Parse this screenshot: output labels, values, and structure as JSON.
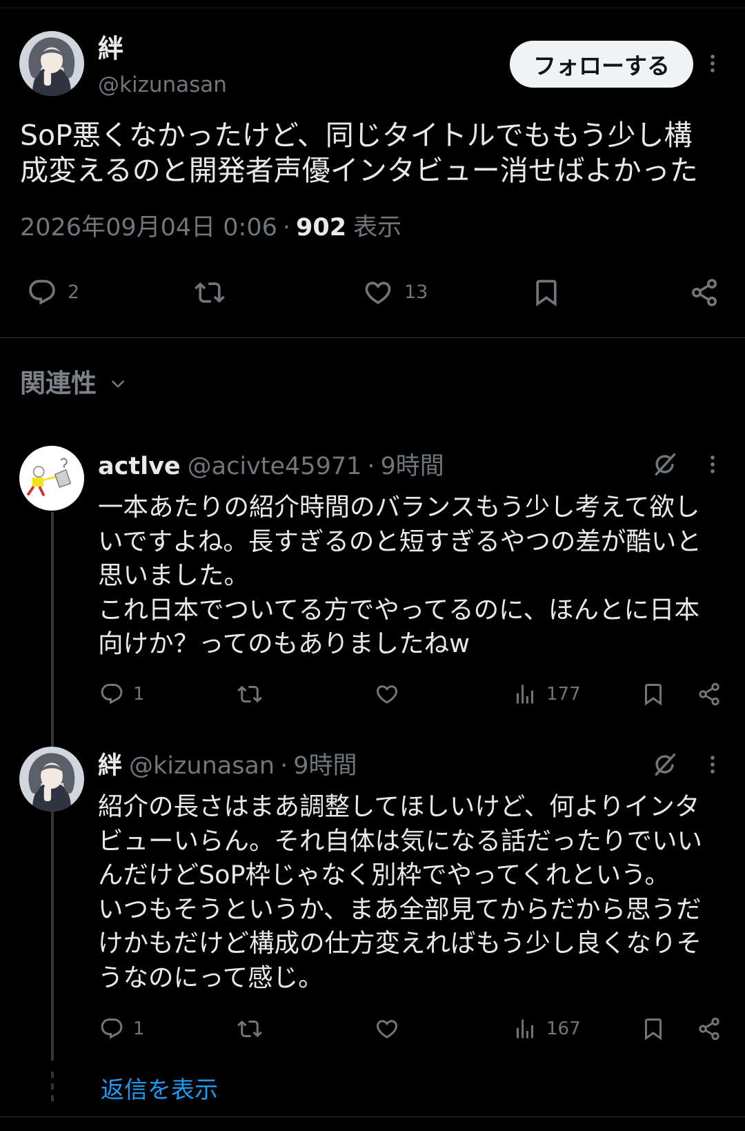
{
  "main_post": {
    "author": {
      "name": "絆",
      "handle": "@kizunasan"
    },
    "follow_label": "フォローする",
    "text_lines": [
      "SoP悪くなかったけど、同じタイトルでももう少し構",
      "成変えるのと開発者声優インタビュー消せばよかった"
    ],
    "timestamp": "2026年09月04日 0:06",
    "separator": "·",
    "views_count": "902",
    "views_label": "表示",
    "reply_count": "2",
    "like_count": "13"
  },
  "sort": {
    "label": "関連性"
  },
  "replies": [
    {
      "name": "actlve",
      "handle": "@acivte45971",
      "separator": "·",
      "time": "9時間",
      "text_lines": [
        "一本あたりの紹介時間のバランスもう少し考えて欲し",
        "いですよね。長すぎるのと短すぎるやつの差が酷いと",
        "思いました。",
        "これ日本でついてる方でやってるのに、ほんとに日本",
        "向けか？ってのもありましたねw"
      ],
      "reply_count": "1",
      "views_count": "177"
    },
    {
      "name": "絆",
      "handle": "@kizunasan",
      "separator": "·",
      "time": "9時間",
      "text_lines": [
        "紹介の長さはまあ調整してほしいけど、何よりインタ",
        "ビューいらん。それ自体は気になる話だったりでいい",
        "んだけどSoP枠じゃなく別枠でやってくれという。",
        "いつもそうというか、まあ全部見てからだから思うだ",
        "けかもだけど構成の仕方変えればもう少し良くなりそ",
        "うなのにって感じ。"
      ],
      "reply_count": "1",
      "views_count": "167"
    }
  ],
  "show_replies_label": "返信を表示",
  "icons": {
    "reply": "reply-icon",
    "retweet": "retweet-icon",
    "like": "like-icon",
    "bookmark": "bookmark-icon",
    "share": "share-icon",
    "views": "views-icon",
    "more": "more-icon",
    "grok": "grok-icon",
    "chevron": "chevron-down-icon"
  },
  "colors": {
    "bg": "#000000",
    "text": "#e7e9ea",
    "secondary": "#71767b",
    "link": "#1d9bf0",
    "divider": "#2f3336",
    "thread": "#333639",
    "follow-bg": "#eff3f4",
    "follow-text": "#0f1419"
  }
}
